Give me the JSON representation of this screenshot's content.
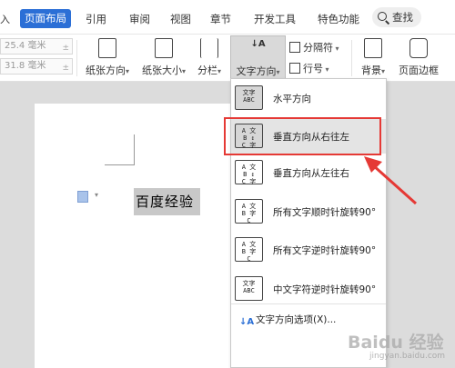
{
  "tabs": {
    "first_partial": "入",
    "active": "页面布局",
    "items": [
      "引用",
      "审阅",
      "视图",
      "章节",
      "开发工具",
      "特色功能"
    ],
    "search_label": "查找"
  },
  "ribbon": {
    "margin_top": "25.4 毫米",
    "margin_bottom": "31.8 毫米",
    "orientation": "纸张方向",
    "size": "纸张大小",
    "columns": "分栏",
    "text_direction": "文字方向",
    "separator": "分隔符",
    "line_number": "行号",
    "background": "背景",
    "page_border": "页面边框"
  },
  "document": {
    "selected_text": "百度经验"
  },
  "menu": {
    "items": [
      {
        "label": "水平方向",
        "icon_text": "文字\nABC",
        "icon": "horizontal-text-icon"
      },
      {
        "label": "垂直方向从右往左",
        "icon_text": "ABC 文字",
        "icon": "vertical-rtl-icon"
      },
      {
        "label": "垂直方向从左往右",
        "icon_text": "文字 ABC",
        "icon": "vertical-ltr-icon"
      },
      {
        "label": "所有文字顺时针旋转90°",
        "icon_text": "ABC 文字",
        "icon": "rotate-cw-icon"
      },
      {
        "label": "所有文字逆时针旋转90°",
        "icon_text": "ABC 文字",
        "icon": "rotate-ccw-icon"
      },
      {
        "label": "中文字符逆时针旋转90°",
        "icon_text": "文字\nABC",
        "icon": "cjk-rotate-icon"
      }
    ],
    "options_label": "文字方向选项(X)..."
  },
  "watermark": {
    "logo": "Baidu 经验",
    "sub": "jingyan.baidu.com"
  },
  "colors": {
    "accent": "#2b6fd6",
    "highlight": "#e53935"
  }
}
